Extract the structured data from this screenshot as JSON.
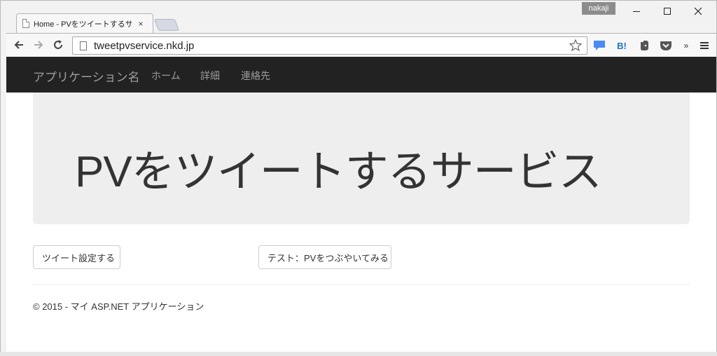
{
  "browser": {
    "tab_title": "Home - PVをツイートするサー",
    "tab_close": "×",
    "user_badge": "nakaji",
    "url": "tweetpvservice.nkd.jp",
    "extensions": {
      "hatena": "B!",
      "more": "»"
    }
  },
  "navbar": {
    "brand": "アプリケーション名",
    "links": [
      "ホーム",
      "詳細",
      "連絡先"
    ]
  },
  "jumbotron": {
    "title": "PVをツイートするサービス"
  },
  "buttons": {
    "tweet_settings": "ツイート設定する",
    "test_tweet": "テスト：PVをつぶやいてみる"
  },
  "footer": {
    "text": "© 2015 - マイ ASP.NET アプリケーション"
  },
  "colors": {
    "navbar_bg": "#222222",
    "navbar_text": "#9d9d9d",
    "jumbotron_bg": "#eeeeee",
    "text": "#333333"
  }
}
